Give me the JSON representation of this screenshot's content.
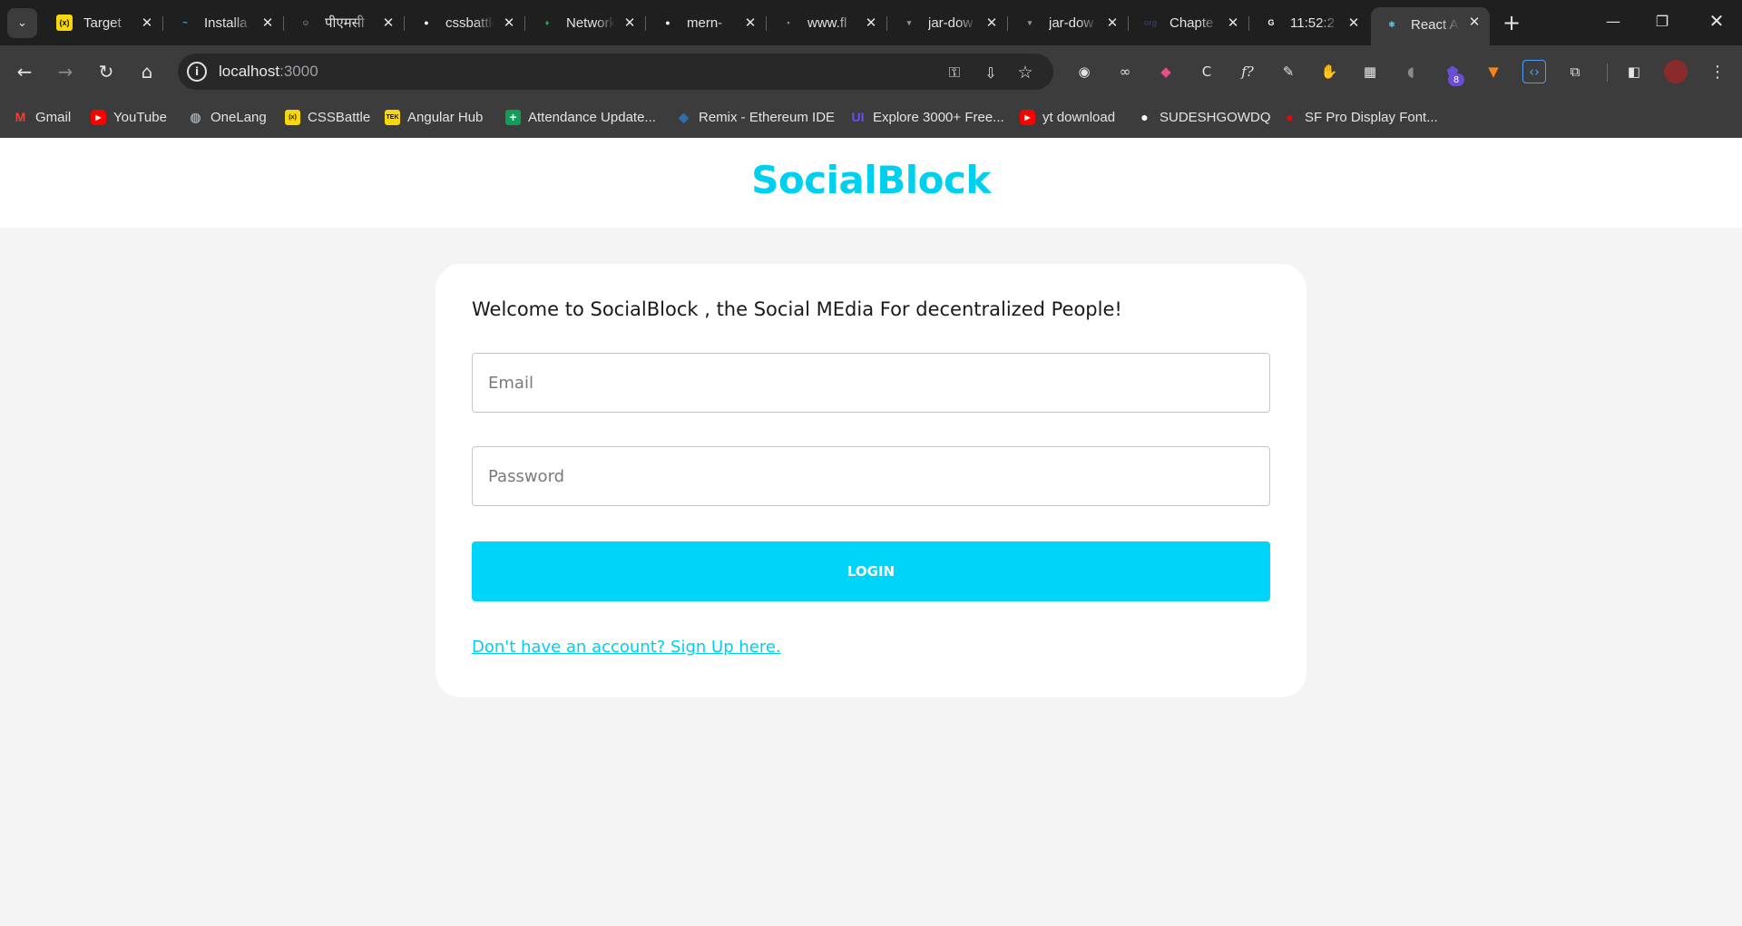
{
  "browser": {
    "tabs": [
      {
        "title": "Target",
        "icon": "xd-icon",
        "color": "#f7d70a",
        "glyph": "(x)"
      },
      {
        "title": "Installa",
        "icon": "tailwind-icon",
        "color": "#38bdf8",
        "glyph": "~"
      },
      {
        "title": "पीएमसी",
        "icon": "avatar-icon",
        "color": "#c9a18a",
        "glyph": "☺"
      },
      {
        "title": "cssbattle",
        "icon": "github-icon",
        "color": "#ffffff",
        "glyph": "●"
      },
      {
        "title": "Network",
        "icon": "mongodb-leaf-icon",
        "color": "#13aa52",
        "glyph": "♦"
      },
      {
        "title": "mern-",
        "icon": "github-icon",
        "color": "#ffffff",
        "glyph": "●"
      },
      {
        "title": "www.fl",
        "icon": "file-icon",
        "color": "#8f8f8f",
        "glyph": "▪"
      },
      {
        "title": "jar-dow",
        "icon": "download-icon",
        "color": "#8f8f8f",
        "glyph": "▾"
      },
      {
        "title": "jar-dow",
        "icon": "download-icon",
        "color": "#8f8f8f",
        "glyph": "▾"
      },
      {
        "title": "Chapte",
        "icon": "org-icon",
        "color": "#2b3a67",
        "glyph": "org"
      },
      {
        "title": "11:52:2",
        "icon": "google-icon",
        "color": "#ffffff",
        "glyph": "G"
      },
      {
        "title": "React A",
        "icon": "react-icon",
        "color": "#61dafb",
        "glyph": "⚛",
        "active": true
      }
    ],
    "address": {
      "host": "localhost",
      "port": ":3000"
    },
    "bookmarks": [
      {
        "label": "Gmail",
        "icon": "gmail-icon",
        "color": "#ea4335",
        "glyph": "M"
      },
      {
        "label": "YouTube",
        "icon": "youtube-icon",
        "color": "#ff0000",
        "glyph": "▶"
      },
      {
        "label": "OneLang",
        "icon": "globe-icon",
        "color": "#9aa0a6",
        "glyph": "◍"
      },
      {
        "label": "CSSBattle",
        "icon": "cssbattle-icon",
        "color": "#f7d70a",
        "glyph": "(x)"
      },
      {
        "label": "Angular Hub",
        "icon": "tek-icon",
        "color": "#f7d70a",
        "glyph": "TEK"
      },
      {
        "label": "Attendance Update...",
        "icon": "sheets-icon",
        "color": "#0f9d58",
        "glyph": "+"
      },
      {
        "label": "Remix - Ethereum IDE",
        "icon": "remix-icon",
        "color": "#2f6fa8",
        "glyph": "◆"
      },
      {
        "label": "Explore 3000+ Free...",
        "icon": "ui-icon",
        "color": "#6c4df6",
        "glyph": "UI"
      },
      {
        "label": "yt download",
        "icon": "youtube-icon",
        "color": "#ff0000",
        "glyph": "▶"
      },
      {
        "label": "SUDESHGOWDQ",
        "icon": "github-icon",
        "color": "#ffffff",
        "glyph": "●"
      },
      {
        "label": "SF Pro Display Font...",
        "icon": "record-icon",
        "color": "#ff0000",
        "glyph": "●"
      }
    ],
    "extension_badge": "8"
  },
  "page": {
    "brand": "SocialBlock",
    "welcome": "Welcome to SocialBlock , the Social MEdia For decentralized People!",
    "email_placeholder": "Email",
    "password_placeholder": "Password",
    "login_label": "LOGIN",
    "signup_link": "Don't have an account? Sign Up here."
  },
  "colors": {
    "accent": "#00d4f8",
    "brand": "#00cfee",
    "page_bg": "#f4f4f4"
  }
}
